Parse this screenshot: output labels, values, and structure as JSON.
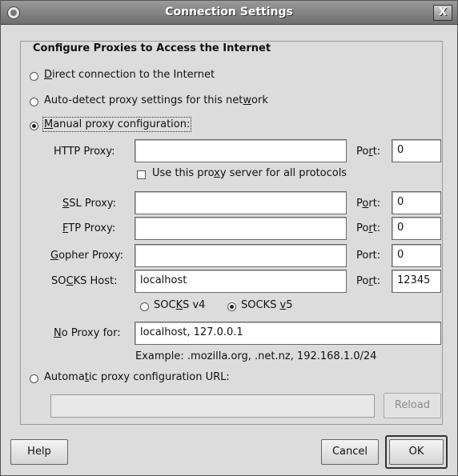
{
  "window": {
    "title": "Connection Settings",
    "close_label": "X"
  },
  "frame": {
    "title": "Configure Proxies to Access the Internet"
  },
  "modes": {
    "direct": {
      "label_pre": "",
      "label_u": "D",
      "label_post": "irect connection to the Internet",
      "selected": false
    },
    "autodetect": {
      "label_pre": "Auto-detect proxy settings for this net",
      "label_u": "w",
      "label_post": "ork",
      "selected": false
    },
    "manual": {
      "label_pre": "",
      "label_u": "M",
      "label_post": "anual proxy configuration:",
      "selected": true
    },
    "auto_url": {
      "label_pre": "Automa",
      "label_u": "t",
      "label_post": "ic proxy configuration URL:",
      "selected": false
    }
  },
  "http": {
    "label_pre": "HTTP Proxy:",
    "value": "",
    "port_label_pre": "Po",
    "port_label_u": "r",
    "port_label_post": "t:",
    "port": "0"
  },
  "share": {
    "label_pre": "Use this pro",
    "label_u": "x",
    "label_post": "y server for all protocols",
    "checked": false
  },
  "ssl": {
    "label_u": "S",
    "label_post": "SL Proxy:",
    "value": "",
    "port_label_pre": "P",
    "port_label_u": "o",
    "port_label_post": "rt:",
    "port": "0"
  },
  "ftp": {
    "label_u": "F",
    "label_post": "TP Proxy:",
    "value": "",
    "port_label_pre": "Po",
    "port_label_u": "r",
    "port_label_post": "t:",
    "port": "0"
  },
  "gopher": {
    "label_u": "G",
    "label_post": "opher Proxy:",
    "value": "",
    "port_label": "Port:",
    "port": "0"
  },
  "socks": {
    "label_pre": "SO",
    "label_u": "C",
    "label_post": "KS Host:",
    "value": "localhost",
    "port_label_pre": "Po",
    "port_label_u": "r",
    "port_label_post": "t:",
    "port": "12345",
    "v4": {
      "label_pre": "SOC",
      "label_u": "K",
      "label_post": "S v4",
      "selected": false
    },
    "v5": {
      "label_pre": "SOCKS ",
      "label_u": "v",
      "label_post": "5",
      "selected": true
    }
  },
  "no_proxy": {
    "label_u": "N",
    "label_post": "o Proxy for:",
    "value": "localhost, 127.0.0.1",
    "example": "Example: .mozilla.org, .net.nz, 192.168.1.0/24"
  },
  "auto_url": {
    "value": "",
    "reload_label": "Reload"
  },
  "buttons": {
    "help": "Help",
    "cancel": "Cancel",
    "ok": "OK"
  }
}
